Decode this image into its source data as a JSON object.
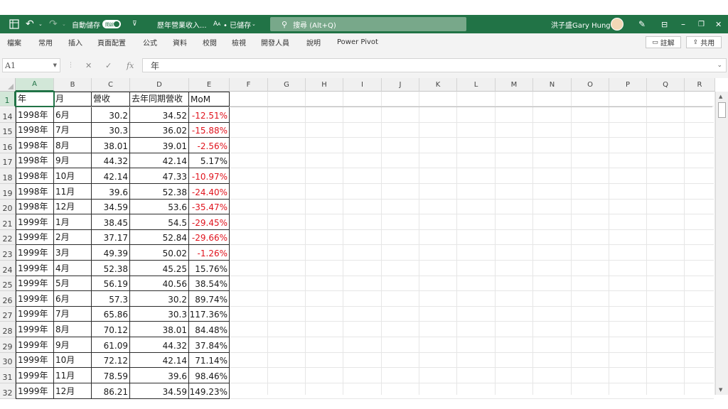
{
  "titlebar": {
    "autosave_label": "自動儲存",
    "autosave_state": "開啟",
    "filename": "歷年營業收入...",
    "saved_status": "• 已儲存",
    "search_placeholder": "搜尋 (Alt+Q)",
    "user_name": "洪子盛Gary Hung"
  },
  "ribbon": {
    "tabs": [
      "檔案",
      "常用",
      "插入",
      "頁面配置",
      "公式",
      "資料",
      "校閱",
      "檢視",
      "開發人員",
      "說明",
      "Power Pivot"
    ],
    "comments_label": "註解",
    "share_label": "共用"
  },
  "formula_bar": {
    "name_box": "A1",
    "formula": "年"
  },
  "grid": {
    "columns": [
      "A",
      "B",
      "C",
      "D",
      "E",
      "F",
      "G",
      "H",
      "I",
      "J",
      "K",
      "L",
      "M",
      "N",
      "O",
      "P",
      "Q",
      "R"
    ],
    "header_row": {
      "row": "1",
      "cells": [
        "年",
        "月",
        "營收",
        "去年同期營收",
        "MoM"
      ]
    },
    "rows": [
      {
        "row": "14",
        "cells": [
          "1998年",
          "6月",
          "30.2",
          "34.52",
          "-12.51%"
        ]
      },
      {
        "row": "15",
        "cells": [
          "1998年",
          "7月",
          "30.3",
          "36.02",
          "-15.88%"
        ]
      },
      {
        "row": "16",
        "cells": [
          "1998年",
          "8月",
          "38.01",
          "39.01",
          "-2.56%"
        ]
      },
      {
        "row": "17",
        "cells": [
          "1998年",
          "9月",
          "44.32",
          "42.14",
          "5.17%"
        ]
      },
      {
        "row": "18",
        "cells": [
          "1998年",
          "10月",
          "42.14",
          "47.33",
          "-10.97%"
        ]
      },
      {
        "row": "19",
        "cells": [
          "1998年",
          "11月",
          "39.6",
          "52.38",
          "-24.40%"
        ]
      },
      {
        "row": "20",
        "cells": [
          "1998年",
          "12月",
          "34.59",
          "53.6",
          "-35.47%"
        ]
      },
      {
        "row": "21",
        "cells": [
          "1999年",
          "1月",
          "38.45",
          "54.5",
          "-29.45%"
        ]
      },
      {
        "row": "22",
        "cells": [
          "1999年",
          "2月",
          "37.17",
          "52.84",
          "-29.66%"
        ]
      },
      {
        "row": "23",
        "cells": [
          "1999年",
          "3月",
          "49.39",
          "50.02",
          "-1.26%"
        ]
      },
      {
        "row": "24",
        "cells": [
          "1999年",
          "4月",
          "52.38",
          "45.25",
          "15.76%"
        ]
      },
      {
        "row": "25",
        "cells": [
          "1999年",
          "5月",
          "56.19",
          "40.56",
          "38.54%"
        ]
      },
      {
        "row": "26",
        "cells": [
          "1999年",
          "6月",
          "57.3",
          "30.2",
          "89.74%"
        ]
      },
      {
        "row": "27",
        "cells": [
          "1999年",
          "7月",
          "65.86",
          "30.3",
          "117.36%"
        ]
      },
      {
        "row": "28",
        "cells": [
          "1999年",
          "8月",
          "70.12",
          "38.01",
          "84.48%"
        ]
      },
      {
        "row": "29",
        "cells": [
          "1999年",
          "9月",
          "61.09",
          "44.32",
          "37.84%"
        ]
      },
      {
        "row": "30",
        "cells": [
          "1999年",
          "10月",
          "72.12",
          "42.14",
          "71.14%"
        ]
      },
      {
        "row": "31",
        "cells": [
          "1999年",
          "11月",
          "78.59",
          "39.6",
          "98.46%"
        ]
      },
      {
        "row": "32",
        "cells": [
          "1999年",
          "12月",
          "86.21",
          "34.59",
          "149.23%"
        ]
      }
    ]
  },
  "colors": {
    "excel_green": "#217346",
    "negative_red": "#e0131d"
  }
}
